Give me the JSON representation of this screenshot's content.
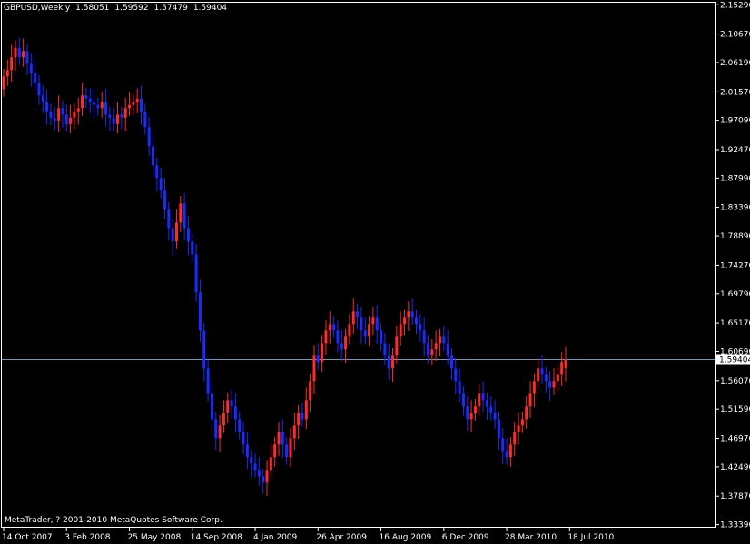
{
  "header": {
    "symbol": "GBPUSD,Weekly",
    "open": "1.58051",
    "high": "1.59592",
    "low": "1.57479",
    "close": "1.59404"
  },
  "copyright": "MetaTrader, ? 2001-2010 MetaQuotes Software Corp.",
  "colors": {
    "bull": "#ff2a2a",
    "bear": "#1a2bff",
    "axis": "#ffffff",
    "bid_line": "#7f97ad",
    "background": "#000000"
  },
  "chart_data": {
    "type": "candlestick",
    "instrument": "GBPUSD",
    "timeframe": "Weekly",
    "ylim": [
      1.3319,
      2.1547
    ],
    "price_ticks": [
      "2.15290",
      "2.10670",
      "2.06190",
      "2.01570",
      "1.97090",
      "1.92470",
      "1.87990",
      "1.83390",
      "1.78890",
      "1.74270",
      "1.69790",
      "1.65170",
      "1.60690",
      "1.56070",
      "1.51590",
      "1.46970",
      "1.42490",
      "1.37870",
      "1.33390"
    ],
    "current_price": "1.59404",
    "time_labels": [
      "14 Oct 2007",
      "3 Feb 2008",
      "25 May 2008",
      "14 Sep 2008",
      "4 Jan 2009",
      "26 Apr 2009",
      "16 Aug 2009",
      "6 Dec 2009",
      "28 Mar 2010",
      "18 Jul 2010"
    ],
    "time_label_index": [
      0,
      16,
      32,
      48,
      64,
      80,
      96,
      112,
      128,
      144
    ],
    "closes": [
      2.04,
      2.05,
      2.07,
      2.085,
      2.07,
      2.08,
      2.06,
      2.045,
      2.03,
      2.01,
      2.0,
      1.985,
      1.975,
      1.97,
      1.99,
      1.98,
      1.965,
      1.975,
      1.985,
      1.99,
      2.01,
      2.005,
      2.0,
      1.995,
      1.99,
      2.0,
      1.98,
      1.975,
      1.965,
      1.98,
      1.975,
      1.99,
      1.995,
      2.0,
      2.005,
      1.985,
      1.96,
      1.93,
      1.9,
      1.88,
      1.86,
      1.83,
      1.8,
      1.78,
      1.81,
      1.84,
      1.8,
      1.78,
      1.76,
      1.7,
      1.64,
      1.58,
      1.54,
      1.5,
      1.47,
      1.49,
      1.51,
      1.53,
      1.52,
      1.5,
      1.48,
      1.46,
      1.44,
      1.43,
      1.42,
      1.41,
      1.4,
      1.42,
      1.44,
      1.46,
      1.48,
      1.46,
      1.44,
      1.47,
      1.49,
      1.51,
      1.5,
      1.53,
      1.56,
      1.6,
      1.59,
      1.62,
      1.64,
      1.65,
      1.64,
      1.62,
      1.61,
      1.63,
      1.65,
      1.67,
      1.66,
      1.64,
      1.63,
      1.65,
      1.66,
      1.64,
      1.62,
      1.6,
      1.58,
      1.6,
      1.63,
      1.65,
      1.66,
      1.67,
      1.66,
      1.65,
      1.64,
      1.62,
      1.6,
      1.61,
      1.62,
      1.63,
      1.62,
      1.6,
      1.58,
      1.56,
      1.54,
      1.52,
      1.5,
      1.51,
      1.52,
      1.54,
      1.53,
      1.52,
      1.51,
      1.5,
      1.47,
      1.45,
      1.44,
      1.46,
      1.48,
      1.49,
      1.5,
      1.52,
      1.54,
      1.56,
      1.58,
      1.57,
      1.56,
      1.55,
      1.56,
      1.57,
      1.59,
      1.594
    ],
    "opens": [
      2.02,
      2.04,
      2.05,
      2.07,
      2.085,
      2.07,
      2.08,
      2.06,
      2.045,
      2.03,
      2.01,
      2.0,
      1.985,
      1.975,
      1.97,
      1.99,
      1.98,
      1.965,
      1.975,
      1.985,
      1.99,
      2.01,
      2.005,
      2.0,
      1.995,
      1.99,
      2.0,
      1.98,
      1.975,
      1.965,
      1.98,
      1.975,
      1.99,
      1.995,
      2.0,
      2.005,
      1.985,
      1.96,
      1.93,
      1.9,
      1.88,
      1.86,
      1.83,
      1.8,
      1.78,
      1.81,
      1.84,
      1.8,
      1.78,
      1.76,
      1.7,
      1.64,
      1.58,
      1.54,
      1.5,
      1.47,
      1.49,
      1.51,
      1.53,
      1.52,
      1.5,
      1.48,
      1.46,
      1.44,
      1.43,
      1.42,
      1.41,
      1.4,
      1.42,
      1.44,
      1.46,
      1.48,
      1.46,
      1.44,
      1.47,
      1.49,
      1.51,
      1.5,
      1.53,
      1.56,
      1.6,
      1.59,
      1.62,
      1.64,
      1.65,
      1.64,
      1.62,
      1.61,
      1.63,
      1.65,
      1.67,
      1.66,
      1.64,
      1.63,
      1.65,
      1.66,
      1.64,
      1.62,
      1.6,
      1.58,
      1.6,
      1.63,
      1.65,
      1.66,
      1.67,
      1.66,
      1.65,
      1.64,
      1.62,
      1.6,
      1.61,
      1.62,
      1.63,
      1.62,
      1.6,
      1.58,
      1.56,
      1.54,
      1.52,
      1.5,
      1.51,
      1.52,
      1.54,
      1.53,
      1.52,
      1.51,
      1.5,
      1.47,
      1.45,
      1.44,
      1.46,
      1.48,
      1.49,
      1.5,
      1.52,
      1.54,
      1.56,
      1.58,
      1.57,
      1.56,
      1.55,
      1.56,
      1.57,
      1.58051
    ]
  }
}
